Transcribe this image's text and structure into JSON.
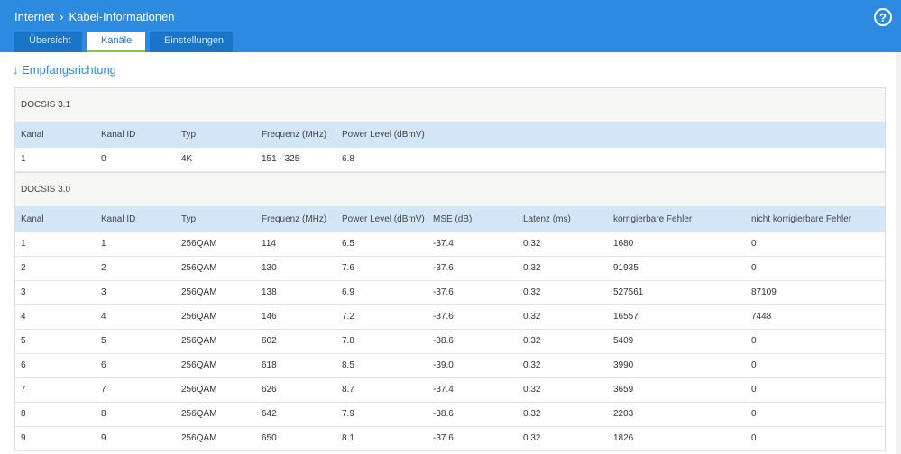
{
  "header": {
    "breadcrumb": [
      "Internet",
      "Kabel-Informationen"
    ],
    "help_icon": "?",
    "tabs": [
      "Übersicht",
      "Kanäle",
      "Einstellungen"
    ],
    "active_tab": "Kanäle"
  },
  "section": {
    "arrow": "↓",
    "title": "Empfangsrichtung"
  },
  "docsis31": {
    "label": "DOCSIS 3.1",
    "columns": [
      "Kanal",
      "Kanal ID",
      "Typ",
      "Frequenz (MHz)",
      "Power Level (dBmV)"
    ],
    "rows": [
      [
        "1",
        "0",
        "4K",
        "151 - 325",
        "6.8"
      ]
    ]
  },
  "docsis30": {
    "label": "DOCSIS 3.0",
    "columns": [
      "Kanal",
      "Kanal ID",
      "Typ",
      "Frequenz (MHz)",
      "Power Level (dBmV)",
      "MSE (dB)",
      "Latenz (ms)",
      "korrigierbare Fehler",
      "nicht korrigierbare Fehler"
    ],
    "rows": [
      [
        "1",
        "1",
        "256QAM",
        "114",
        "6.5",
        "-37.4",
        "0.32",
        "1680",
        "0"
      ],
      [
        "2",
        "2",
        "256QAM",
        "130",
        "7.6",
        "-37.6",
        "0.32",
        "91935",
        "0"
      ],
      [
        "3",
        "3",
        "256QAM",
        "138",
        "6.9",
        "-37.6",
        "0.32",
        "527561",
        "87109"
      ],
      [
        "4",
        "4",
        "256QAM",
        "146",
        "7.2",
        "-37.6",
        "0.32",
        "16557",
        "7448"
      ],
      [
        "5",
        "5",
        "256QAM",
        "602",
        "7.8",
        "-38.6",
        "0.32",
        "5409",
        "0"
      ],
      [
        "6",
        "6",
        "256QAM",
        "618",
        "8.5",
        "-39.0",
        "0.32",
        "3990",
        "0"
      ],
      [
        "7",
        "7",
        "256QAM",
        "626",
        "8.7",
        "-37.4",
        "0.32",
        "3659",
        "0"
      ],
      [
        "8",
        "8",
        "256QAM",
        "642",
        "7.9",
        "-38.6",
        "0.32",
        "2203",
        "0"
      ],
      [
        "9",
        "9",
        "256QAM",
        "650",
        "8.1",
        "-37.6",
        "0.32",
        "1826",
        "0"
      ]
    ]
  }
}
